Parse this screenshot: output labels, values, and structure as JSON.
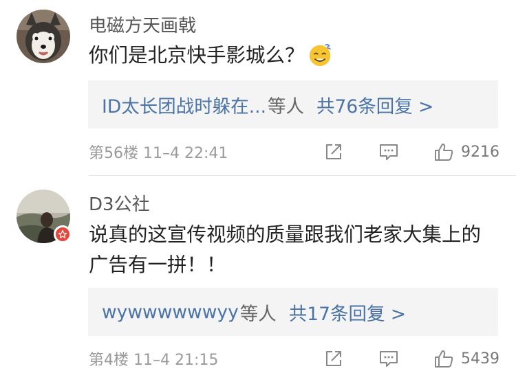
{
  "comments": [
    {
      "username": "电磁方天画戟",
      "content": "你们是北京快手影城么？",
      "emoji": "sweat-smile-emoji",
      "reply_users": "ID太长团战时躲在...",
      "reply_others": "等人",
      "reply_count": "共76条回复 >",
      "meta": "第56楼  11–4  22:41",
      "likes": "9216"
    },
    {
      "username": "D3公社",
      "content": "说真的这宣传视频的质量跟我们老家大集上的广告有一拼！！",
      "reply_users": "wywwwwwwyy",
      "reply_others": "等人",
      "reply_count": "共17条回复 >",
      "meta": "第4楼  11–4  21:15",
      "likes": "5439"
    }
  ],
  "colors": {
    "link": "#4a73a8",
    "meta": "#9a9a9a",
    "reply_bg": "#f4f4f4",
    "badge": "#e8463a"
  }
}
